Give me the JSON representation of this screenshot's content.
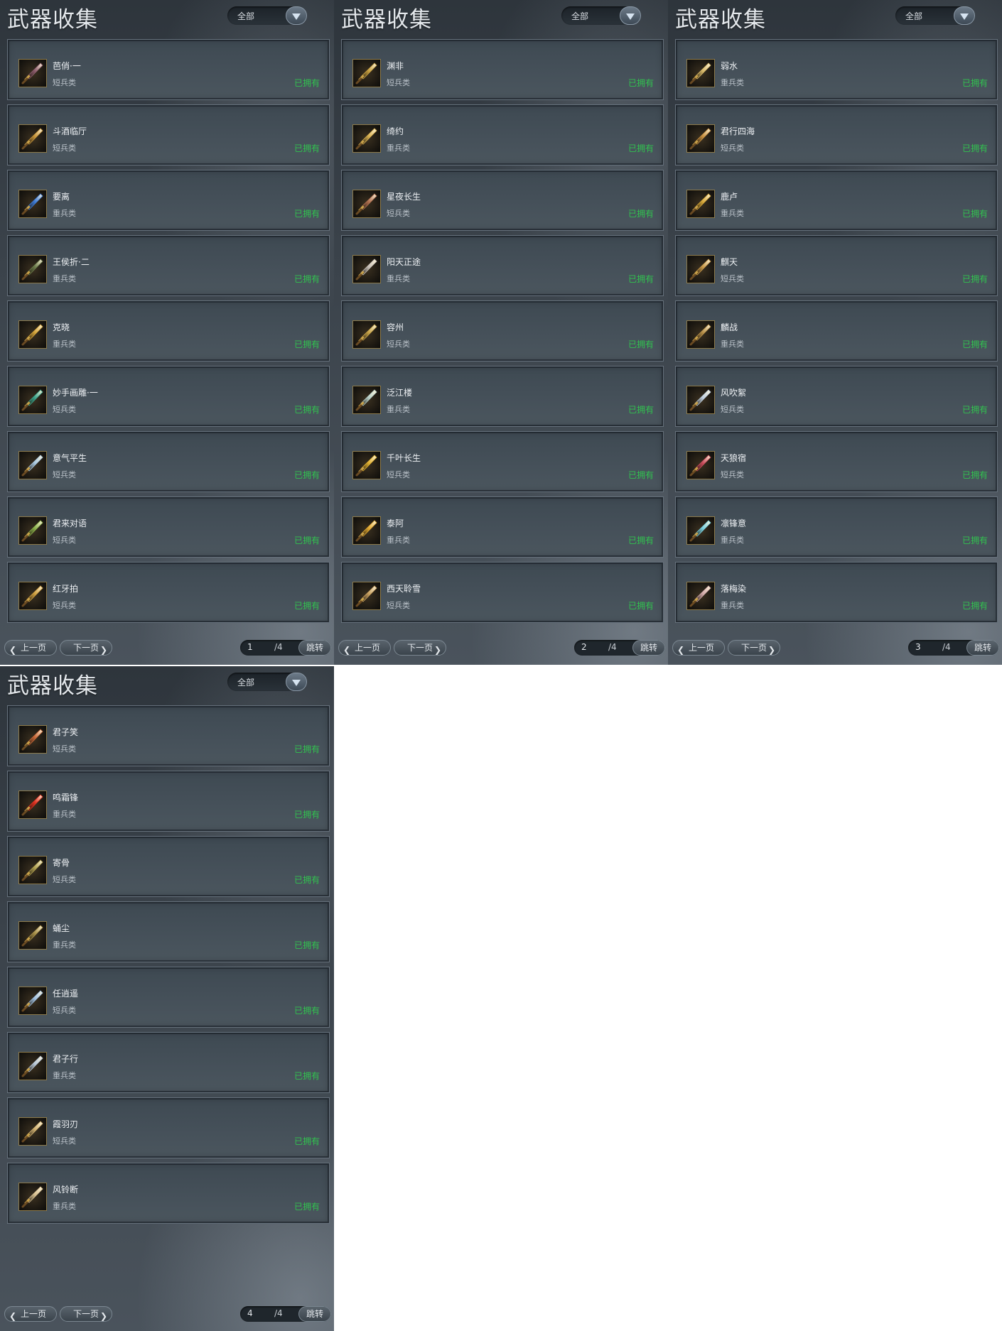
{
  "colors": {
    "owned": "#31c34f",
    "title": "#e4e8ec"
  },
  "pages": [
    {
      "title": "武器收集",
      "filter": "全部",
      "prev_label": "上一页",
      "next_label": "下一页",
      "page_input": "1",
      "page_total": "/4",
      "jump_label": "跳转",
      "items": [
        {
          "name": "芭俏·一",
          "category": "短兵类",
          "status": "已拥有",
          "icon": "dagger-icon",
          "hue": "#8a5a6a"
        },
        {
          "name": "斗酒临厅",
          "category": "短兵类",
          "status": "已拥有",
          "icon": "gold-blade-icon",
          "hue": "#c9963a"
        },
        {
          "name": "要离",
          "category": "重兵类",
          "status": "已拥有",
          "icon": "blue-blade-icon",
          "hue": "#3d7bd6"
        },
        {
          "name": "王侯折·二",
          "category": "重兵类",
          "status": "已拥有",
          "icon": "dark-sword-icon",
          "hue": "#6a7a4a"
        },
        {
          "name": "克晓",
          "category": "重兵类",
          "status": "已拥有",
          "icon": "gold-blade-icon",
          "hue": "#d4a43a"
        },
        {
          "name": "妙手画雕·一",
          "category": "短兵类",
          "status": "已拥有",
          "icon": "jade-sword-icon",
          "hue": "#3aa38a"
        },
        {
          "name": "意气平生",
          "category": "短兵类",
          "status": "已拥有",
          "icon": "silver-sword-icon",
          "hue": "#a8c8e0"
        },
        {
          "name": "君来对语",
          "category": "短兵类",
          "status": "已拥有",
          "icon": "green-sword-icon",
          "hue": "#8ab04a"
        },
        {
          "name": "红牙拍",
          "category": "短兵类",
          "status": "已拥有",
          "icon": "gold-sword-icon",
          "hue": "#d0a040"
        }
      ]
    },
    {
      "title": "武器收集",
      "filter": "全部",
      "prev_label": "上一页",
      "next_label": "下一页",
      "page_input": "2",
      "page_total": "/4",
      "jump_label": "跳转",
      "items": [
        {
          "name": "渊非",
          "category": "短兵类",
          "status": "已拥有",
          "icon": "gold-sword-icon",
          "hue": "#c8a040"
        },
        {
          "name": "绮约",
          "category": "重兵类",
          "status": "已拥有",
          "icon": "gold-blade-icon",
          "hue": "#d8b050"
        },
        {
          "name": "星夜长生",
          "category": "短兵类",
          "status": "已拥有",
          "icon": "dagger-icon",
          "hue": "#b07050"
        },
        {
          "name": "阳天正途",
          "category": "重兵类",
          "status": "已拥有",
          "icon": "silver-blade-icon",
          "hue": "#c8c0b8"
        },
        {
          "name": "容州",
          "category": "短兵类",
          "status": "已拥有",
          "icon": "gold-sword-icon",
          "hue": "#c8a448"
        },
        {
          "name": "泛江楼",
          "category": "重兵类",
          "status": "已拥有",
          "icon": "silver-blade-icon",
          "hue": "#b8d0c8"
        },
        {
          "name": "千叶长生",
          "category": "短兵类",
          "status": "已拥有",
          "icon": "gold-sword-icon",
          "hue": "#e0b030"
        },
        {
          "name": "泰阿",
          "category": "重兵类",
          "status": "已拥有",
          "icon": "gold-blade-icon",
          "hue": "#e0a830"
        },
        {
          "name": "西天聆雪",
          "category": "短兵类",
          "status": "已拥有",
          "icon": "gold-sword-icon",
          "hue": "#c8a060"
        }
      ]
    },
    {
      "title": "武器收集",
      "filter": "全部",
      "prev_label": "上一页",
      "next_label": "下一页",
      "page_input": "3",
      "page_total": "/4",
      "jump_label": "跳转",
      "items": [
        {
          "name": "弱水",
          "category": "重兵类",
          "status": "已拥有",
          "icon": "gold-blade-icon",
          "hue": "#d8b868"
        },
        {
          "name": "君行四海",
          "category": "短兵类",
          "status": "已拥有",
          "icon": "gold-sword-icon",
          "hue": "#c89040"
        },
        {
          "name": "鹿卢",
          "category": "重兵类",
          "status": "已拥有",
          "icon": "gold-blade-icon",
          "hue": "#d8a838"
        },
        {
          "name": "麒天",
          "category": "短兵类",
          "status": "已拥有",
          "icon": "gold-sword-icon",
          "hue": "#c89848"
        },
        {
          "name": "麟战",
          "category": "重兵类",
          "status": "已拥有",
          "icon": "gold-sword-icon",
          "hue": "#b89048"
        },
        {
          "name": "风吹絮",
          "category": "短兵类",
          "status": "已拥有",
          "icon": "silver-sword-icon",
          "hue": "#c0d0e0"
        },
        {
          "name": "天狼宿",
          "category": "短兵类",
          "status": "已拥有",
          "icon": "red-sword-icon",
          "hue": "#c84a5a"
        },
        {
          "name": "凛锋意",
          "category": "重兵类",
          "status": "已拥有",
          "icon": "ice-blade-icon",
          "hue": "#78d0e0"
        },
        {
          "name": "落梅染",
          "category": "重兵类",
          "status": "已拥有",
          "icon": "silver-blade-icon",
          "hue": "#d0a8a8"
        }
      ]
    },
    {
      "title": "武器收集",
      "filter": "全部",
      "prev_label": "上一页",
      "next_label": "下一页",
      "page_input": "4",
      "page_total": "/4",
      "jump_label": "跳转",
      "items": [
        {
          "name": "君子笑",
          "category": "短兵类",
          "status": "已拥有",
          "icon": "red-sword-icon",
          "hue": "#c86838"
        },
        {
          "name": "鸣霜锋",
          "category": "重兵类",
          "status": "已拥有",
          "icon": "red-blade-icon",
          "hue": "#e03020"
        },
        {
          "name": "寄骨",
          "category": "短兵类",
          "status": "已拥有",
          "icon": "gold-sword-icon",
          "hue": "#b0a050"
        },
        {
          "name": "蛹尘",
          "category": "重兵类",
          "status": "已拥有",
          "icon": "gold-blade-icon",
          "hue": "#a89048"
        },
        {
          "name": "任逍遥",
          "category": "短兵类",
          "status": "已拥有",
          "icon": "silver-sword-icon",
          "hue": "#a0c0e0"
        },
        {
          "name": "君子行",
          "category": "重兵类",
          "status": "已拥有",
          "icon": "silver-blade-icon",
          "hue": "#b8c8d8"
        },
        {
          "name": "霞羽刃",
          "category": "短兵类",
          "status": "已拥有",
          "icon": "gold-sword-icon",
          "hue": "#d0b070"
        },
        {
          "name": "风铃断",
          "category": "重兵类",
          "status": "已拥有",
          "icon": "bone-blade-icon",
          "hue": "#d8c090"
        }
      ]
    }
  ]
}
